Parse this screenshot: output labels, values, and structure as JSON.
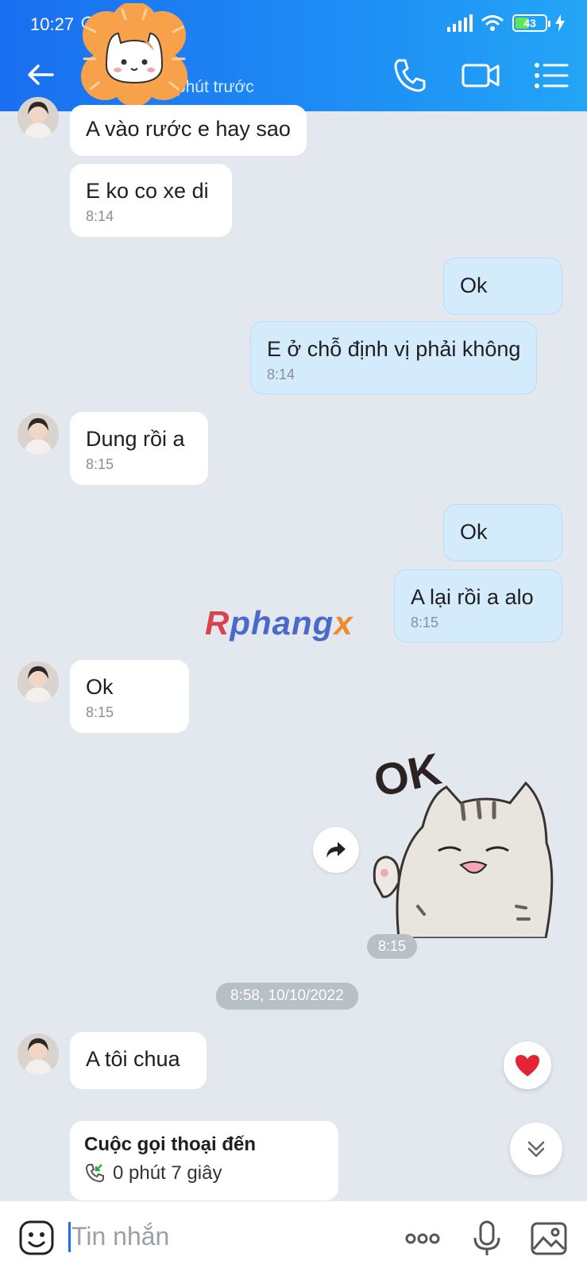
{
  "status_bar": {
    "time": "10:27",
    "battery": "43"
  },
  "header": {
    "subtitle": "Truy cập 12 phút trước"
  },
  "messages": [
    {
      "side": "in",
      "text": "A vào rước e hay sao",
      "time": ""
    },
    {
      "side": "in",
      "text": "E ko co xe di",
      "time": "8:14"
    },
    {
      "side": "out",
      "text": "Ok",
      "time": ""
    },
    {
      "side": "out",
      "text": "E ở chỗ định vị phải không",
      "time": "8:14"
    },
    {
      "side": "in",
      "text": "Dung rồi a",
      "time": "8:15"
    },
    {
      "side": "out",
      "text": "Ok",
      "time": ""
    },
    {
      "side": "out",
      "text": "A lại rồi a alo",
      "time": "8:15"
    },
    {
      "side": "in",
      "text": "Ok",
      "time": "8:15"
    },
    {
      "side": "out",
      "type": "sticker",
      "sticker_text": "OK",
      "time": "8:15"
    },
    {
      "side": "in",
      "text": "A tôi chua",
      "time": ""
    }
  ],
  "date_separator": "8:58, 10/10/2022",
  "call_card": {
    "title": "Cuộc gọi thoại đến",
    "duration": "0 phút 7 giây"
  },
  "watermark": {
    "part1": "R",
    "part2": "phang",
    "part3": "x"
  },
  "input": {
    "placeholder": "Tin nhắn"
  },
  "colors": {
    "header_start": "#1a6ef0",
    "header_end": "#23a5f6",
    "bubble_out": "#d4ebfc",
    "bubble_in": "#ffffff",
    "background": "#e3e8ef"
  }
}
